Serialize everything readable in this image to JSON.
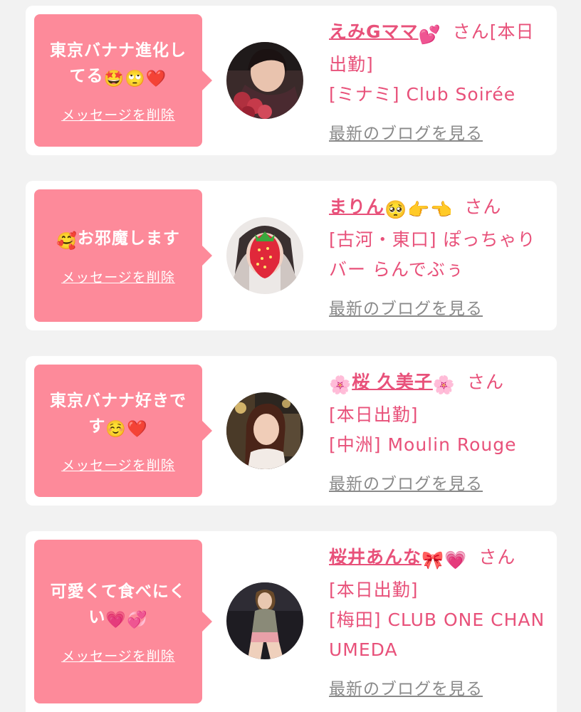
{
  "cards": [
    {
      "message_text": "東京バナナ進化してる",
      "message_emojis": "🤩🙄❤️",
      "delete_label": "メッセージを削除",
      "name": "えみGママ",
      "name_emoji": "💕",
      "honorific": "さん",
      "status": "[本日出勤]",
      "area": "[ミナミ]",
      "shop": "Club Soirée",
      "blog_label": "最新のブログを見る"
    },
    {
      "message_emoji_prefix": "🥰",
      "message_text": "お邪魔します",
      "delete_label": "メッセージを削除",
      "name": "まりん",
      "name_emoji": "🥺👉👈",
      "honorific": "さん",
      "area": "[古河・東口]",
      "shop": "ぽっちゃりバー らんでぶぅ",
      "blog_label": "最新のブログを見る"
    },
    {
      "message_text": "東京バナナ好きです",
      "message_emojis": "☺️❤️",
      "delete_label": "メッセージを削除",
      "name_emoji_prefix": "🌸",
      "name": "桜 久美子",
      "name_emoji": "🌸",
      "honorific": "さん",
      "status": "[本日出勤]",
      "area": "[中洲]",
      "shop": "Moulin Rouge",
      "blog_label": "最新のブログを見る"
    },
    {
      "message_text": "可愛くて食べにくい",
      "message_emojis": "💗💞",
      "delete_label": "メッセージを削除",
      "name": "桜井あんな",
      "name_emoji": "🎀💗",
      "honorific": "さん",
      "status": "[本日出勤]",
      "area": "[梅田]",
      "shop": "CLUB ONE CHAN UMEDA",
      "blog_label": "最新のブログを見る"
    }
  ],
  "colors": {
    "bubble": "#fd8a9a",
    "accent": "#e8517a",
    "muted": "#8a8a8a",
    "background": "#f2f2f2"
  }
}
